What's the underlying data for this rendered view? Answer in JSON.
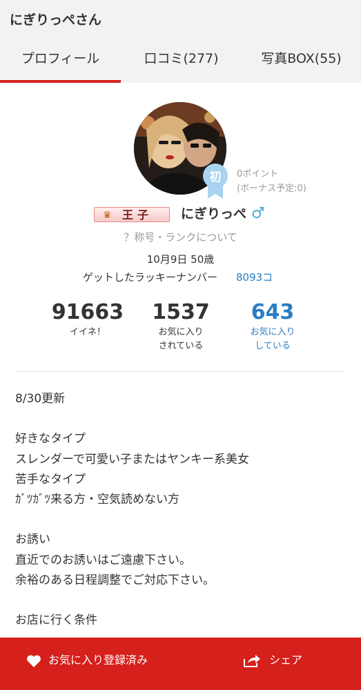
{
  "header": {
    "title": "にぎりっぺさん"
  },
  "tabs": [
    {
      "label": "プロフィール",
      "active": true
    },
    {
      "label": "口コミ(277)"
    },
    {
      "label": "写真BOX(55)"
    }
  ],
  "profile": {
    "points": "0ポイント",
    "bonus_pending": "(ボーナス予定:0)",
    "first_badge": "初",
    "rank_title": "王子",
    "nickname": "にぎりっぺ",
    "gender_symbol": "♂",
    "rank_link": "？称号・ランクについて",
    "birth_age": "10月9日 50歳",
    "lucky_label": "ゲットしたラッキーナンバー",
    "lucky_value": "8093コ"
  },
  "stats": [
    {
      "value": "91663",
      "label_line1": "イイネ！",
      "label_line2": ""
    },
    {
      "value": "1537",
      "label_line1": "お気に入り",
      "label_line2": "されている"
    },
    {
      "value": "643",
      "label_line1": "お気に入り",
      "label_line2": "している"
    }
  ],
  "intro": [
    "8/30更新",
    "",
    "好きなタイプ",
    "スレンダーで可愛い子またはヤンキー系美女",
    "苦手なタイプ",
    "ｶﾞﾂｶﾞﾂ来る方・空気読めない方",
    "",
    "お誘い",
    "直近でのお誘いはご遠慮下さい。",
    "余裕のある日程調整でご対応下さい。",
    "",
    "お店に行く条件"
  ],
  "footer": {
    "favorite_label": "お気に入り登録済み",
    "share_label": "シェア"
  },
  "colors": {
    "accent_red": "#d6201c",
    "link_blue": "#2b7cc4",
    "gender_blue": "#4aa9d8",
    "muted_gray": "#999999"
  }
}
